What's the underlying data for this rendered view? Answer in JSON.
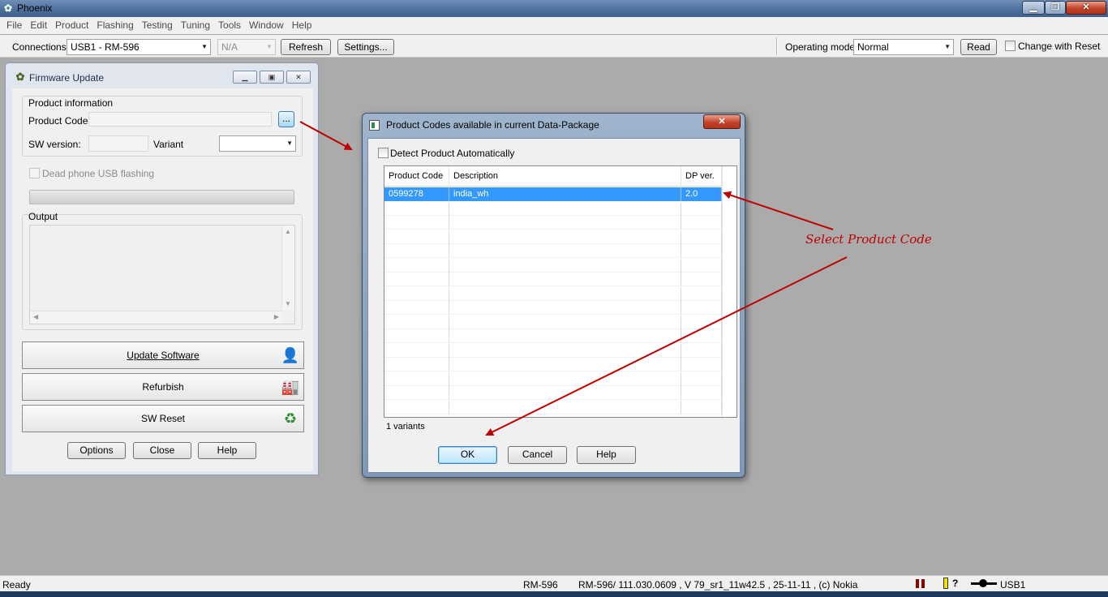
{
  "app": {
    "title": "Phoenix",
    "window_buttons": {
      "minimize": "▁",
      "restore": "❐",
      "close": "✕"
    }
  },
  "menu": [
    "File",
    "Edit",
    "Product",
    "Flashing",
    "Testing",
    "Tuning",
    "Tools",
    "Window",
    "Help"
  ],
  "toolbar": {
    "connections_label": "Connections:",
    "connection_value": "USB1 - RM-596",
    "secondary_value": "N/A",
    "refresh_label": "Refresh",
    "settings_label": "Settings...",
    "operating_mode_label": "Operating mode:",
    "operating_mode_value": "Normal",
    "read_label": "Read",
    "change_with_reset_label": "Change with Reset"
  },
  "firmware": {
    "title": "Firmware Update",
    "product_information_label": "Product information",
    "product_code_label": "Product Code:",
    "browse_label": "...",
    "sw_version_label": "SW version:",
    "variant_label": "Variant",
    "dead_phone_label": "Dead phone USB flashing",
    "output_label": "Output",
    "update_software_label": "Update Software",
    "refurbish_label": "Refurbish",
    "sw_reset_label": "SW Reset",
    "options_label": "Options",
    "close_label": "Close",
    "help_label": "Help"
  },
  "dialog": {
    "title": "Product Codes available in current Data-Package",
    "detect_label": "Detect Product Automatically",
    "columns": [
      "Product Code",
      "Description",
      "DP ver."
    ],
    "rows": [
      {
        "code": "0599278",
        "description": "india_wh",
        "dp_ver": "2.0",
        "selected": true
      }
    ],
    "variants_text": "1 variants",
    "ok_label": "OK",
    "cancel_label": "Cancel",
    "help_label": "Help"
  },
  "annotation": {
    "text": "Select Product Code",
    "color": "#c00000"
  },
  "status": {
    "ready": "Ready",
    "product": "RM-596",
    "version_info": "RM-596/ 111.030.0609 , V 79_sr1_11w42.5 , 25-11-11 , (c) Nokia",
    "connection": "USB1"
  },
  "colors": {
    "selection": "#3399ff",
    "annotation_arrow": "#c00000",
    "desktop_bg": "#ababab"
  }
}
